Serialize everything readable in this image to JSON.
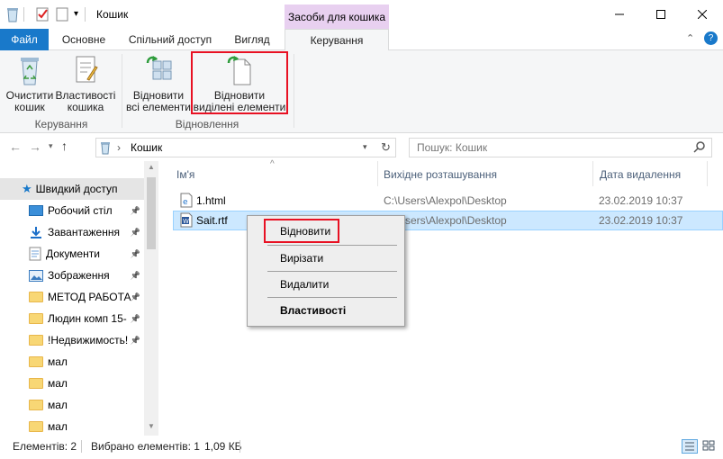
{
  "window": {
    "title": "Кошик",
    "contextual_group": "Засоби для кошика"
  },
  "tabs": {
    "file": "Файл",
    "home": "Основне",
    "share": "Спільний доступ",
    "view": "Вигляд",
    "manage": "Керування"
  },
  "ribbon": {
    "empty_bin": [
      "Очистити",
      "кошик"
    ],
    "properties": [
      "Властивості",
      "кошика"
    ],
    "restore_all": [
      "Відновити",
      "всі елементи"
    ],
    "restore_selected": [
      "Відновити",
      "виділені елементи"
    ],
    "group_manage": "Керування",
    "group_restore": "Відновлення"
  },
  "address": {
    "path": "Кошик",
    "search_placeholder": "Пошук: Кошик"
  },
  "nav": {
    "quick_access": "Швидкий доступ",
    "items": [
      {
        "label": "Робочий стіл",
        "pinned": true
      },
      {
        "label": "Завантаження",
        "pinned": true
      },
      {
        "label": "Документи",
        "pinned": true
      },
      {
        "label": "Зображення",
        "pinned": true
      },
      {
        "label": "МЕТОД РАБОТА",
        "pinned": true
      },
      {
        "label": "Людин комп 15-",
        "pinned": true
      },
      {
        "label": "!Недвижимость!",
        "pinned": true
      },
      {
        "label": "мал",
        "pinned": false
      },
      {
        "label": "мал",
        "pinned": false
      },
      {
        "label": "мал",
        "pinned": false
      },
      {
        "label": "мал",
        "pinned": false
      }
    ]
  },
  "files": {
    "columns": [
      "Ім'я",
      "Вихідне розташування",
      "Дата видалення"
    ],
    "rows": [
      {
        "name": "1.html",
        "location": "C:\\Users\\Alexpol\\Desktop",
        "date": "23.02.2019 10:37",
        "selected": false
      },
      {
        "name": "Sait.rtf",
        "location": "C:\\Users\\Alexpol\\Desktop",
        "date": "23.02.2019 10:37",
        "selected": true
      }
    ]
  },
  "context_menu": {
    "restore": "Відновити",
    "cut": "Вирізати",
    "delete": "Видалити",
    "properties": "Властивості"
  },
  "status": {
    "count": "Елементів: 2",
    "selected": "Вибрано елементів: 1",
    "size": "1,09 КБ"
  },
  "colors": {
    "accent": "#1979ca",
    "highlight_red": "#e81123",
    "selection": "#cce8ff",
    "contextual_tab": "#e8d0f0"
  }
}
